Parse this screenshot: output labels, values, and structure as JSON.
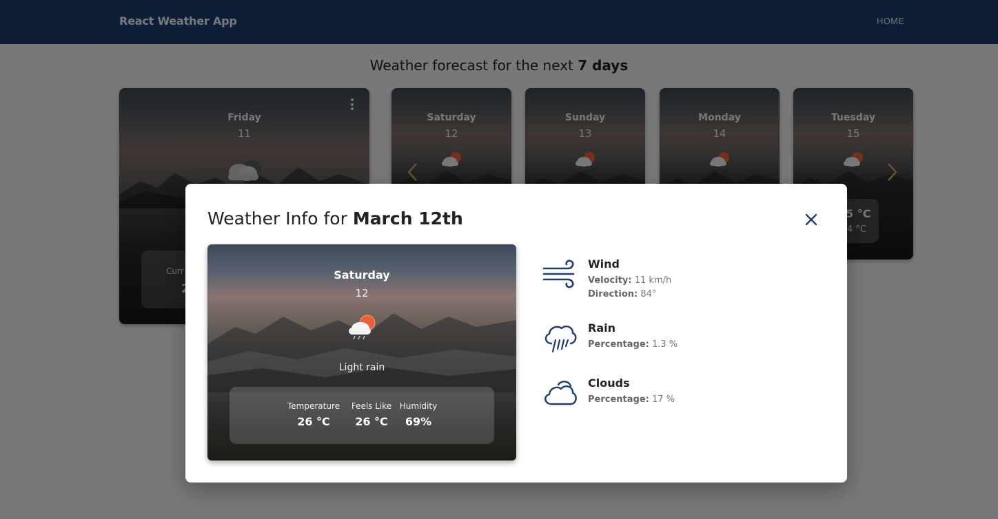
{
  "navbar": {
    "brand": "React Weather App",
    "home_label": "HOME"
  },
  "heading": {
    "prefix": "Weather forecast for the next",
    "highlight": "7 days"
  },
  "forecast": {
    "main": {
      "day": "Friday",
      "date": "11",
      "icon": "cloud-icon",
      "current_label": "Curr",
      "current_value": "2"
    },
    "cards": [
      {
        "day": "Saturday",
        "date": "12",
        "icon": "cloud-sun-rain-icon"
      },
      {
        "day": "Sunday",
        "date": "13",
        "icon": "cloud-sun-rain-icon"
      },
      {
        "day": "Monday",
        "date": "14",
        "icon": "cloud-sun-rain-icon"
      },
      {
        "day": "Tuesday",
        "date": "15",
        "icon": "cloud-sun-rain-icon",
        "temp": "5 °C",
        "feels": "4 °C"
      }
    ]
  },
  "modal": {
    "title_prefix": "Weather Info for",
    "title_date": "March 12th",
    "card": {
      "day": "Saturday",
      "date": "12",
      "icon": "cloud-sun-rain-icon",
      "description": "Light rain",
      "stats": [
        {
          "label": "Temperature",
          "value": "26 °C"
        },
        {
          "label": "Feels Like",
          "value": "26 °C"
        },
        {
          "label": "Humidity",
          "value": "69%"
        }
      ]
    },
    "wind": {
      "title": "Wind",
      "velocity_label": "Velocity:",
      "velocity_value": "11 km/h",
      "direction_label": "Direction:",
      "direction_value": "84°"
    },
    "rain": {
      "title": "Rain",
      "percentage_label": "Percentage:",
      "percentage_value": "1.3 %"
    },
    "clouds": {
      "title": "Clouds",
      "percentage_label": "Percentage:",
      "percentage_value": "17 %"
    }
  },
  "colors": {
    "navbar": "#1d3d6e",
    "icon_blue": "#1d3d6e",
    "arrow": "#c9a36a",
    "sun": "#e8603c"
  }
}
